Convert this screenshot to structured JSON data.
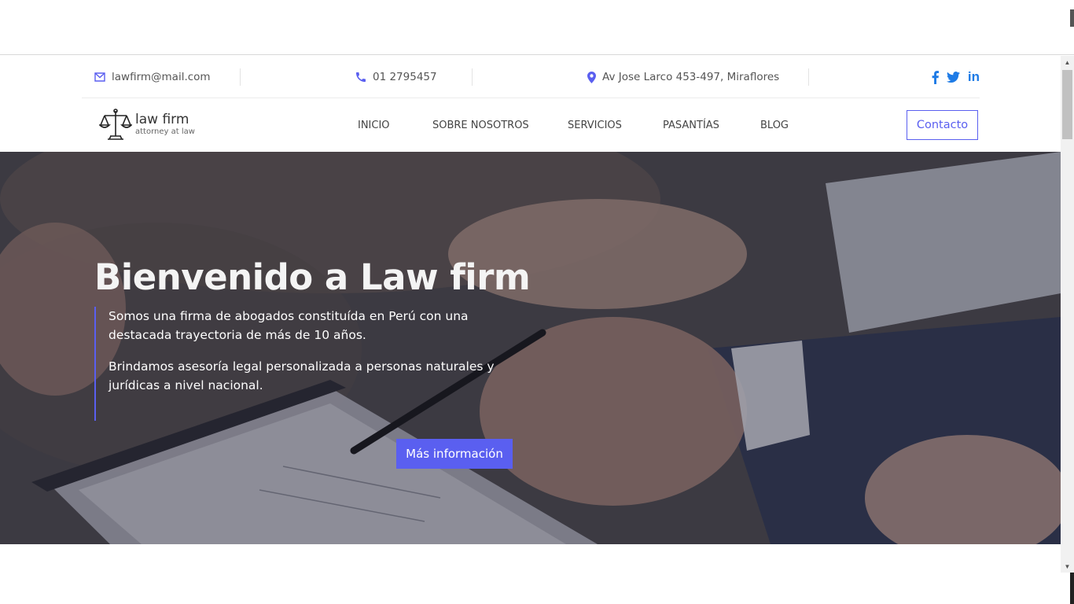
{
  "topbar": {
    "email": "lawfirm@mail.com",
    "phone": "01 2795457",
    "address": "Av Jose Larco 453-497, Miraflores",
    "socials": [
      "facebook-icon",
      "twitter-icon",
      "linkedin-icon"
    ],
    "socials_linkedin_text": "in"
  },
  "logo": {
    "name": "law firm",
    "subtitle": "attorney at law"
  },
  "nav": {
    "items": [
      "INICIO",
      "SOBRE NOSOTROS",
      "SERVICIOS",
      "PASANTÍAS",
      "BLOG"
    ],
    "contact_label": "Contacto"
  },
  "hero": {
    "title_prefix": "Bienvenido a",
    "title_bold": "Law firm",
    "paragraph_1": "Somos una firma de abogados constituída en Perú con una destacada trayectoria de más de 10 años.",
    "paragraph_2": "Brindamos asesoría legal personalizada a personas naturales y jurídicas a nivel nacional.",
    "button_label": "Más información"
  },
  "colors": {
    "accent": "#5a5ff0",
    "social": "#1e7be6",
    "text_gray": "#555555"
  }
}
